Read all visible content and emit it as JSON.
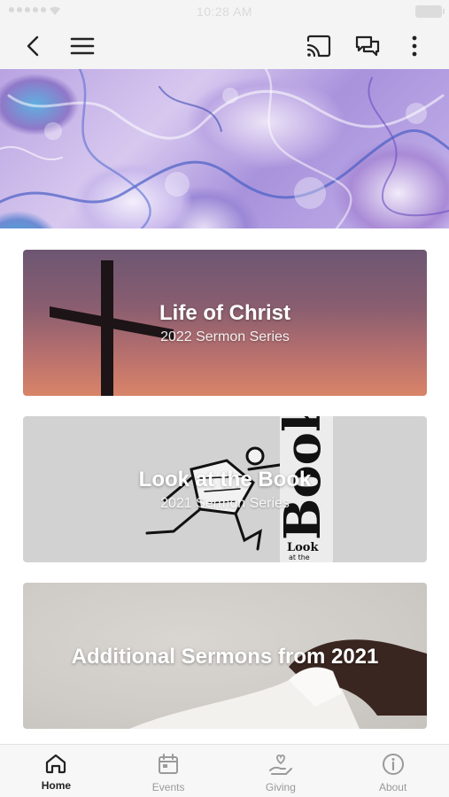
{
  "status_bar": {
    "time": "10:28 AM"
  },
  "nav": {
    "back": "back-icon",
    "menu": "menu-icon",
    "cast": "cast-icon",
    "chat": "chat-icon",
    "more": "more-icon"
  },
  "cards": [
    {
      "title": "Life of Christ",
      "subtitle": "2022 Sermon Series"
    },
    {
      "title": "Look at the Book",
      "subtitle": "2021 Sermon Series",
      "art_text": "Book",
      "art_small_1": "Look",
      "art_small_2": "at the"
    },
    {
      "title": "Additional Sermons from 2021",
      "subtitle": ""
    }
  ],
  "tabs": [
    {
      "label": "Home",
      "icon": "home-icon",
      "active": true
    },
    {
      "label": "Events",
      "icon": "calendar-icon",
      "active": false
    },
    {
      "label": "Giving",
      "icon": "giving-icon",
      "active": false
    },
    {
      "label": "About",
      "icon": "info-icon",
      "active": false
    }
  ],
  "colors": {
    "active_tab": "#222222",
    "inactive_tab": "#9a9a9a",
    "bar_bg": "#f4f4f4"
  }
}
